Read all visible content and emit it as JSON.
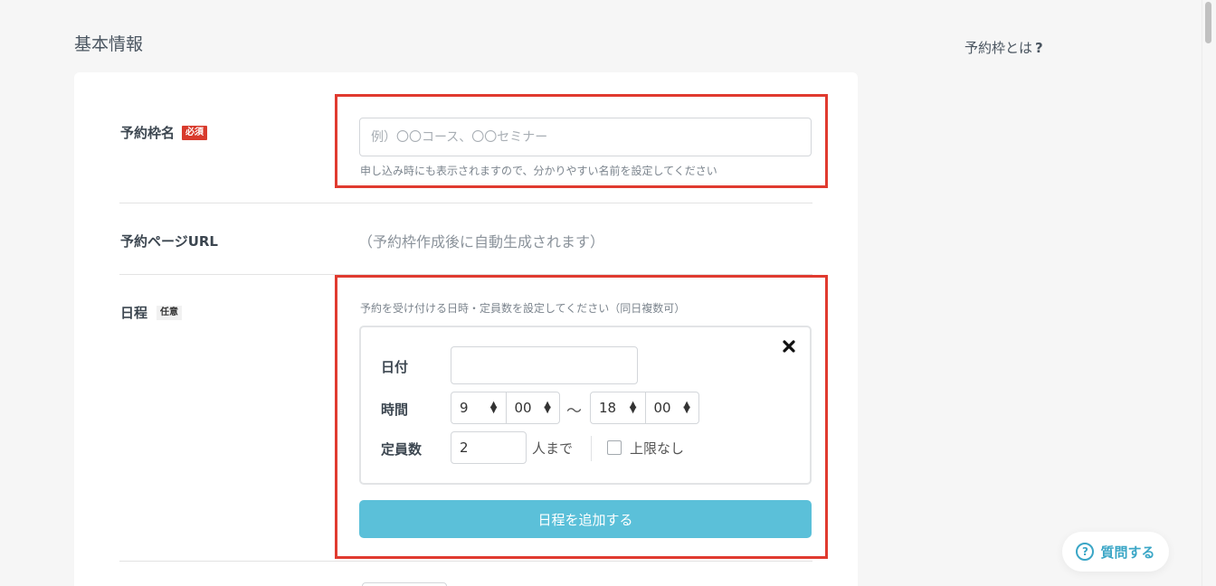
{
  "page": {
    "section_title": "基本情報",
    "help_link": {
      "label": "予約枠とは",
      "icon": "?"
    }
  },
  "fields": {
    "name": {
      "label": "予約枠名",
      "badge": "必須",
      "placeholder": "例）〇〇コース、〇〇セミナー",
      "value": "",
      "hint": "申し込み時にも表示されますので、分かりやすい名前を設定してください"
    },
    "url": {
      "label": "予約ページURL",
      "value": "（予約枠作成後に自動生成されます）"
    },
    "schedule": {
      "label": "日程",
      "badge": "任意",
      "hint": "予約を受け付ける日時・定員数を設定してください（同日複数可）",
      "date_label": "日付",
      "date_value": "",
      "time_label": "時間",
      "start_hour": "9",
      "start_minute": "00",
      "separator": "〜",
      "end_hour": "18",
      "end_minute": "00",
      "capacity_label": "定員数",
      "capacity_value": "2",
      "capacity_unit": "人まで",
      "unlimited_label": "上限なし",
      "unlimited_checked": false,
      "add_button": "日程を追加する"
    }
  },
  "floating": {
    "ask_button": "質問する",
    "ask_icon": "?"
  },
  "colors": {
    "required_badge": "#d83a2c",
    "highlight_frame": "#e03a2f",
    "primary_button": "#5bc0d9",
    "link_accent": "#3aa6c6"
  }
}
